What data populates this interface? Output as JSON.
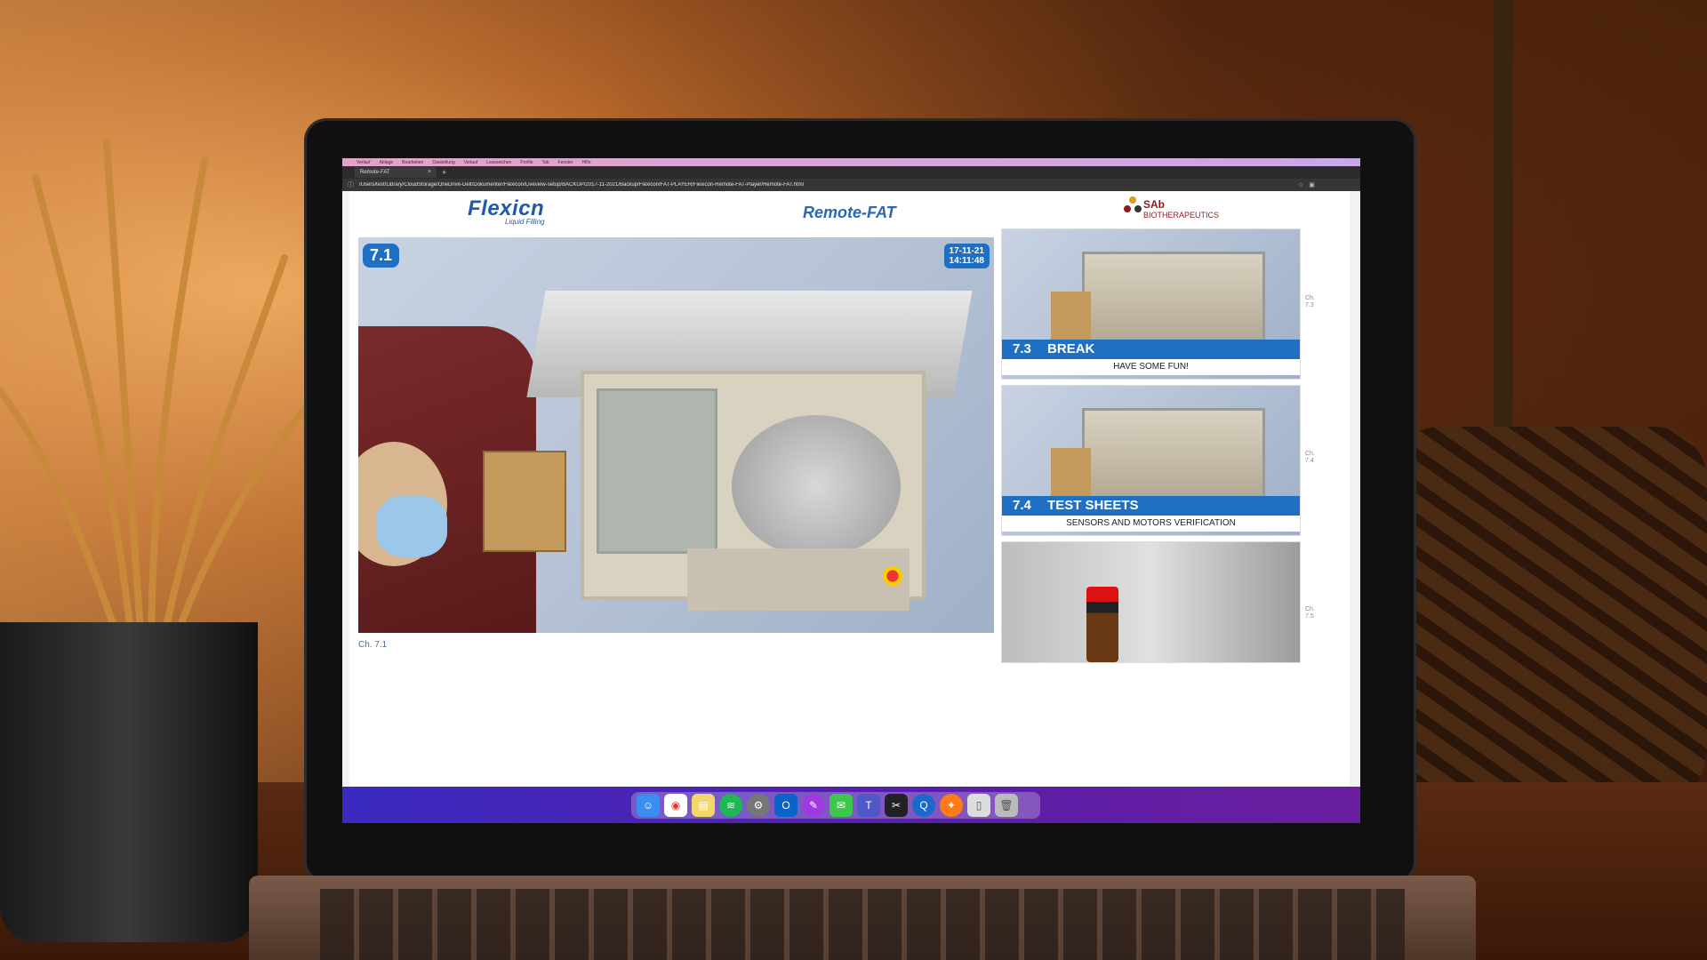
{
  "browser": {
    "menu": [
      "Verlauf",
      "Ablage",
      "Bearbeiten",
      "Darstellung",
      "Verlauf",
      "Lesezeichen",
      "Profile",
      "Tab",
      "Fenster",
      "Hilfe"
    ],
    "tab_title": "Remote-FAT",
    "address": "/Users/test/Library/CloudStorage/OneDrive-Delt/Dokumenter/Flexicon/Liveview-setup/BACKUP/2017-11-2021/Backup/Flexicon/FAT-PLAYER/Flexicon-Remote-FAT-Player/Remote-FAT.html"
  },
  "header": {
    "logo_main": "Flexicn",
    "logo_sub": "Liquid Filling",
    "title": "Remote-FAT",
    "partner_name": "SAb",
    "partner_sub": "BIOTHERAPEUTICS"
  },
  "main_video": {
    "chapter_badge": "7.1",
    "timestamp_date": "17-11-21",
    "timestamp_time": "14:11:48",
    "caption": "Ch. 7.1"
  },
  "chapters": [
    {
      "num": "7.3",
      "title": "BREAK",
      "subtitle": "HAVE SOME FUN!",
      "side_label": "Ch. 7.3"
    },
    {
      "num": "7.4",
      "title": "TEST SHEETS",
      "subtitle": "SENSORS AND MOTORS VERIFICATION",
      "side_label": "Ch. 7.4"
    },
    {
      "num": "",
      "title": "",
      "subtitle": "",
      "side_label": "Ch. 7.5"
    }
  ],
  "dock": {
    "icons": [
      "finder-icon",
      "chrome-icon",
      "notes-icon",
      "spotify-icon",
      "settings-icon",
      "outlook-icon",
      "messenger-icon",
      "messages-icon",
      "teams-icon",
      "final-cut-icon",
      "quicktime-icon",
      "firefox-icon",
      "document-icon",
      "trash-icon"
    ]
  },
  "colors": {
    "brand_blue": "#1f6fc2",
    "partner_red": "#8c1c1c",
    "dock_gradient_start": "#3a2ac0",
    "dock_gradient_end": "#6b1fa0"
  }
}
